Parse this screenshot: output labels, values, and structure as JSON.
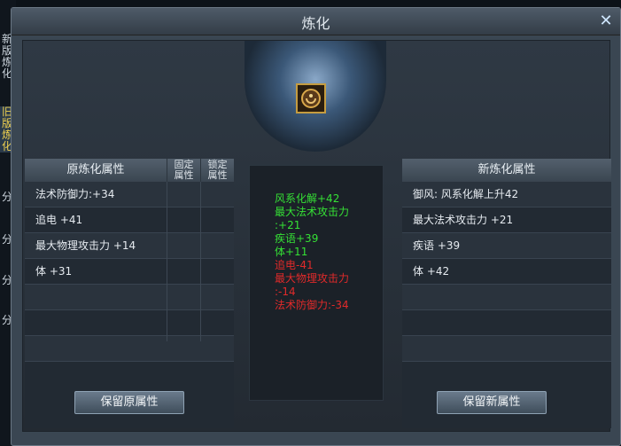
{
  "window": {
    "title": "炼化",
    "close_icon": "close-icon"
  },
  "side_tabs": [
    {
      "label": "新\n版\n炼\n化"
    },
    {
      "label": "旧\n版\n炼\n化"
    },
    {
      "label": "分"
    },
    {
      "label": "分"
    },
    {
      "label": "分"
    },
    {
      "label": "分"
    }
  ],
  "original": {
    "header": "原炼化属性",
    "fixed_header": "固定\n属性",
    "locked_header": "锁定\n属性",
    "rows": [
      "法术防御力:+34",
      "追电 +41",
      "最大物理攻击力 +14",
      "体 +31",
      "",
      "",
      ""
    ],
    "keep_button": "保留原属性"
  },
  "new": {
    "header": "新炼化属性",
    "rows": [
      "御风: 风系化解上升42",
      "最大法术攻击力 +21",
      "疾语 +39",
      "体 +42",
      "",
      "",
      ""
    ],
    "keep_button": "保留新属性"
  },
  "diff": {
    "gains": [
      "风系化解+42",
      "最大法术攻击力",
      ":+21",
      "疾语+39",
      "体+11"
    ],
    "losses": [
      "追电-41",
      "最大物理攻击力",
      ":-14",
      "法术防御力:-34"
    ],
    "gain_color": "#35e035",
    "loss_color": "#e02a2a"
  },
  "item_slot_icon": "amulet-icon"
}
